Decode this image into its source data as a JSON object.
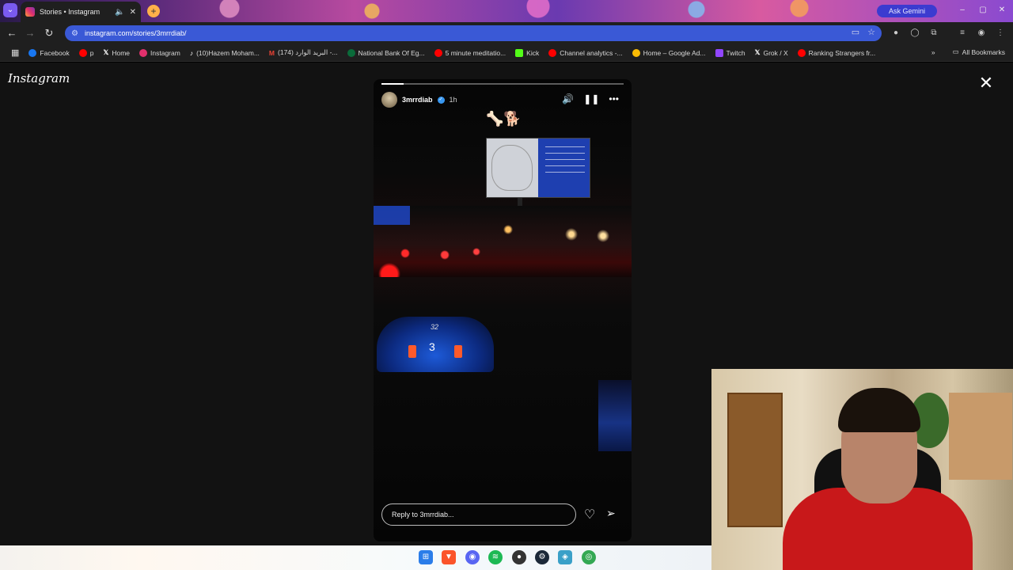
{
  "browser": {
    "tab_title": "Stories • Instagram",
    "url": "instagram.com/stories/3mrrdiab/",
    "gemini_label": "Ask Gemini"
  },
  "bookmarks": [
    {
      "label": "Facebook",
      "color": "#1877f2"
    },
    {
      "label": "p",
      "color": "#ff0000"
    },
    {
      "label": "Home",
      "color": "#ffffff"
    },
    {
      "label": "Instagram",
      "color": "#e1306c"
    },
    {
      "label": "(10)Hazem Moham...",
      "color": "#000000"
    },
    {
      "label": "(174) البريد الوارد -...",
      "color": "#ea4335"
    },
    {
      "label": "National Bank Of Eg...",
      "color": "#0a6b3a"
    },
    {
      "label": "5 minute meditatio...",
      "color": "#ff0000"
    },
    {
      "label": "Kick",
      "color": "#53fc18"
    },
    {
      "label": "Channel analytics -...",
      "color": "#ff0000"
    },
    {
      "label": "Home – Google Ad...",
      "color": "#fbbc04"
    },
    {
      "label": "Twitch",
      "color": "#9146ff"
    },
    {
      "label": "Grok / X",
      "color": "#ffffff"
    },
    {
      "label": "Ranking Strangers fr...",
      "color": "#ff0000"
    }
  ],
  "all_bookmarks": "All Bookmarks",
  "page": {
    "logo": "Instagram"
  },
  "story": {
    "username": "3mrrdiab",
    "time": "1h",
    "reply_placeholder": "Reply to 3mrrdiab...",
    "progress": 0.09,
    "speed": "32",
    "gear": "3"
  }
}
